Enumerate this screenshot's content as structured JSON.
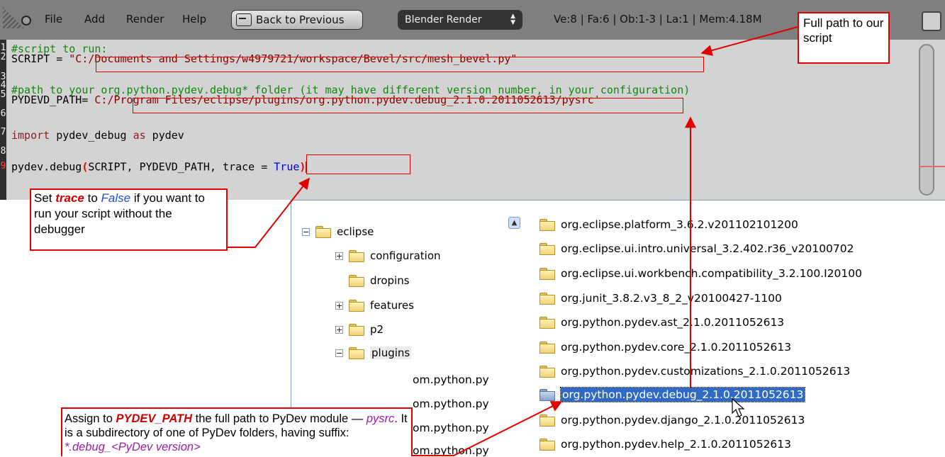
{
  "header": {
    "menus": [
      "File",
      "Add",
      "Render",
      "Help"
    ],
    "back_button": "Back to Previous",
    "render_engine": "Blender Render",
    "stats": "Ve:8 | Fa:6 | Ob:1-3 | La:1 | Mem:4.18M"
  },
  "editor": {
    "line_numbers": [
      "1",
      "2",
      "3",
      "4",
      "5",
      "6",
      "7",
      "8",
      "9"
    ],
    "line1": "#script to run:",
    "line2_var": "SCRIPT = ",
    "line2_str": "\"C:/Documents and Settings/w4979721/workspace/Bevel/src/mesh_bevel.py\"",
    "line4": "#path to your org.python.pydev.debug* folder (it may have different version number, in your configuration)",
    "line5_var": "PYDEVD_PATH= ",
    "line5_str": "C:/Program Files/eclipse/plugins/org.python.pydev.debug_2.1.0.2011052613/pysrc'",
    "line7_kw1": "import",
    "line7_mod": " pydev_debug ",
    "line7_kw2": "as",
    "line7_alias": " pydev",
    "line9_call": "pydev.debug",
    "line9_args": "SCRIPT, PYDEVD_PATH, ",
    "line9_trace": "trace = ",
    "line9_true": "True"
  },
  "tree": {
    "items": [
      "eclipse",
      "configuration",
      "dropins",
      "features",
      "p2",
      "plugins"
    ]
  },
  "list": {
    "items": [
      "org.eclipse.platform_3.6.2.v201102101200",
      "org.eclipse.ui.intro.universal_3.2.402.r36_v20100702",
      "org.eclipse.ui.workbench.compatibility_3.2.100.I20100",
      "org.junit_3.8.2.v3_8_2_v20100427-1100",
      "org.python.pydev.ast_2.1.0.2011052613",
      "org.python.pydev.core_2.1.0.2011052613",
      "org.python.pydev.customizations_2.1.0.2011052613",
      "org.python.pydev.debug_2.1.0.2011052613",
      "org.python.pydev.django_2.1.0.2011052613",
      "org.python.pydev.help_2.1.0.2011052613"
    ],
    "clipped": [
      "om.python.py",
      "om.python.py",
      "om.python.py",
      "om.python.py"
    ]
  },
  "callouts": {
    "path": "Full path to our script",
    "trace_1": "Set ",
    "trace_word": "trace",
    "trace_2": " to ",
    "trace_false": "False",
    "trace_3": " if you want to run your script without the debugger",
    "assign_1": "Assign to ",
    "assign_word": "PYDEV_PATH",
    "assign_2": " the full path to PyDev module — ",
    "assign_pysrc": "pysrc",
    "assign_3": ". It is a subdirectory of one of PyDev folders, having suffix:",
    "assign_suffix": "*.debug_<PyDev version>"
  }
}
